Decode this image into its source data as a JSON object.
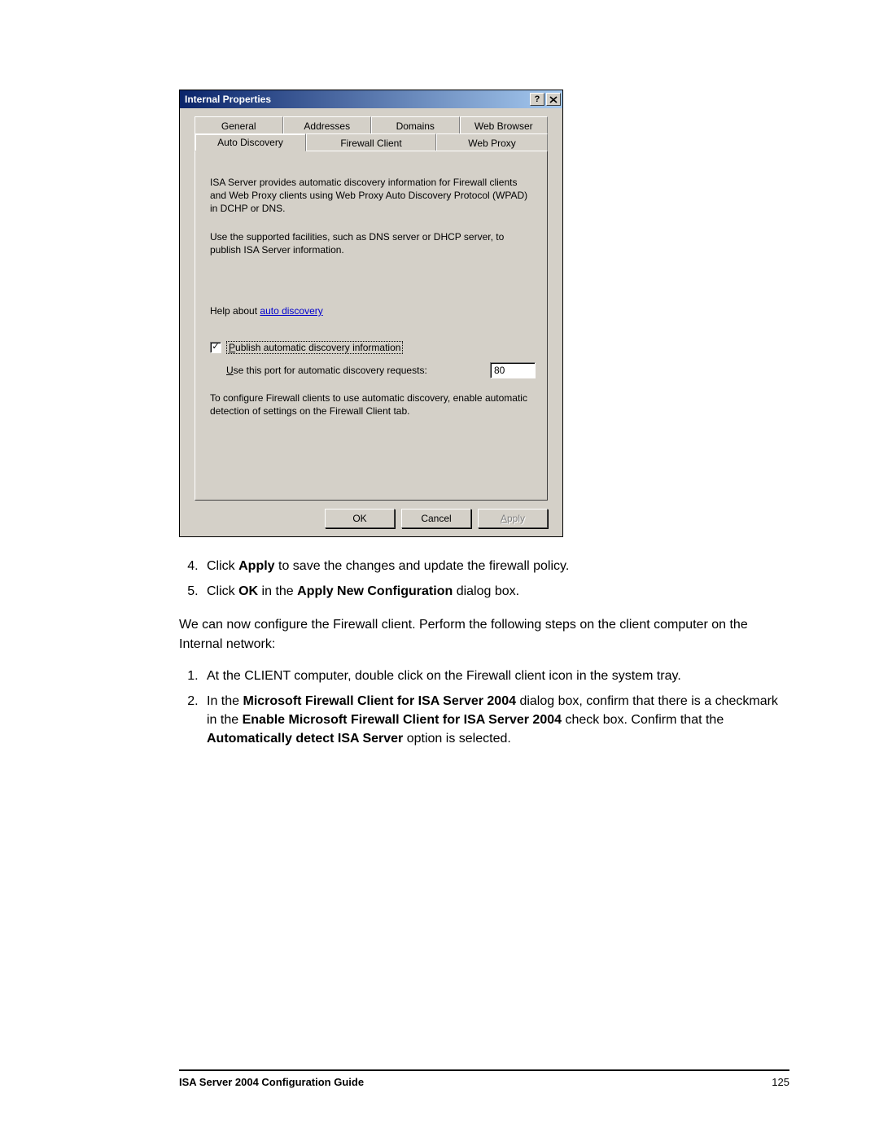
{
  "dialog": {
    "title": "Internal Properties",
    "help_button": "?",
    "close_button": "×",
    "tabs_row1": [
      "General",
      "Addresses",
      "Domains",
      "Web Browser"
    ],
    "tabs_row2": [
      "Auto Discovery",
      "Firewall Client",
      "Web Proxy"
    ],
    "active_tab": "Auto Discovery",
    "para1": "ISA Server provides automatic discovery information for Firewall clients and Web Proxy clients using Web Proxy Auto Discovery Protocol (WPAD) in DCHP or DNS.",
    "para2": "Use the supported facilities, such as DNS server or DHCP server, to publish ISA Server information.",
    "help_prefix": "Help about ",
    "help_link": "auto discovery",
    "checkbox_label": "Publish automatic discovery information",
    "checkbox_checked": true,
    "port_label_pre": "U",
    "port_label_rest": "se this port for automatic discovery requests:",
    "port_value": "80",
    "para3": "To configure Firewall clients to use automatic discovery, enable automatic detection of settings on the Firewall Client tab.",
    "buttons": {
      "ok": "OK",
      "cancel": "Cancel",
      "apply": "Apply"
    }
  },
  "doc": {
    "step4_pre": "Click ",
    "step4_bold": "Apply",
    "step4_post": " to save the changes and update the firewall policy.",
    "step5_pre": "Click ",
    "step5_bold1": "OK",
    "step5_mid": " in the ",
    "step5_bold2": "Apply New Configuration",
    "step5_post": " dialog box.",
    "intro": "We can now configure the Firewall client. Perform the following steps on the client computer on the Internal network:",
    "s1": "At the CLIENT computer, double click on the Firewall client icon in the system tray.",
    "s2_pre": "In the ",
    "s2_b1": "Microsoft Firewall Client for ISA Server 2004",
    "s2_mid1": " dialog box, confirm that there is a checkmark in the ",
    "s2_b2": "Enable Microsoft Firewall Client for ISA Server 2004",
    "s2_mid2": " check box. Confirm that the ",
    "s2_b3": "Automatically detect ISA Server",
    "s2_post": " option is selected."
  },
  "footer": {
    "title": "ISA Server 2004 Configuration Guide",
    "page": "125"
  }
}
